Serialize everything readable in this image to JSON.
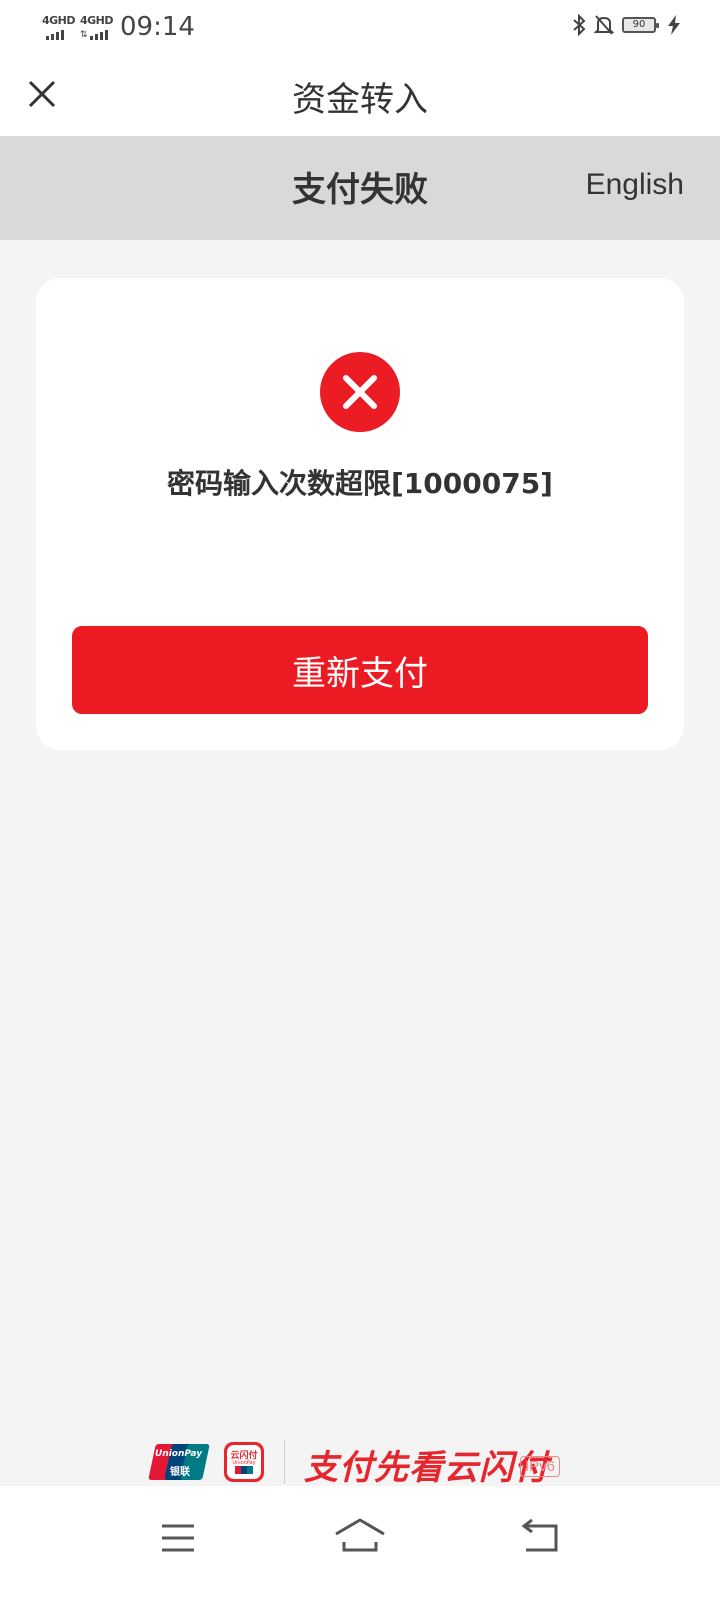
{
  "status_bar": {
    "sim1": "4GHD",
    "sim2": "4GHD",
    "time": "09:14",
    "battery": "90",
    "icons": [
      "bluetooth-icon",
      "bell-off-icon",
      "battery-icon",
      "charging-icon"
    ]
  },
  "nav": {
    "title": "资金转入",
    "close_icon": "close-icon"
  },
  "header": {
    "title": "支付失败",
    "language_link": "English"
  },
  "result": {
    "icon": "error-icon",
    "message": "密码输入次数超限[1000075]",
    "retry_button": "重新支付"
  },
  "footer": {
    "unionpay_text": "UnionPay",
    "unionpay_cn": "银联",
    "app_label": "云闪付",
    "app_sub": "UnionPay",
    "slogan": "支付先看云闪付",
    "ipv6": "IPv6"
  },
  "colors": {
    "accent": "#ec1b23",
    "header_bg": "#d9d9d9",
    "page_bg": "#f4f4f4"
  },
  "system_nav": [
    "menu-icon",
    "home-icon",
    "back-icon"
  ]
}
